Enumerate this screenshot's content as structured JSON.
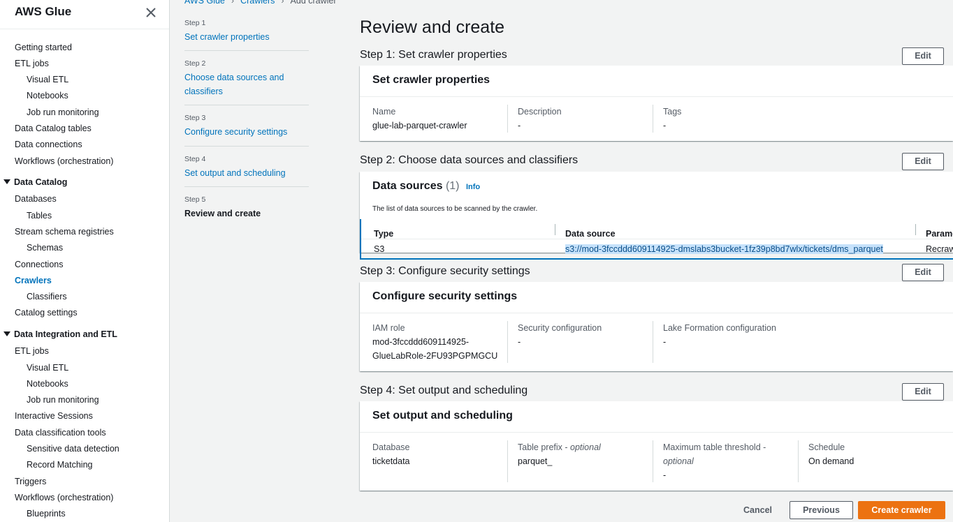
{
  "sidebar": {
    "title": "AWS Glue",
    "items": [
      {
        "label": "Getting started"
      },
      {
        "label": "ETL jobs"
      },
      {
        "label": "Visual ETL"
      },
      {
        "label": "Notebooks"
      },
      {
        "label": "Job run monitoring"
      },
      {
        "label": "Data Catalog tables"
      },
      {
        "label": "Data connections"
      },
      {
        "label": "Workflows (orchestration)"
      },
      {
        "label": "Data Catalog"
      },
      {
        "label": "Databases"
      },
      {
        "label": "Tables"
      },
      {
        "label": "Stream schema registries"
      },
      {
        "label": "Schemas"
      },
      {
        "label": "Connections"
      },
      {
        "label": "Crawlers"
      },
      {
        "label": "Classifiers"
      },
      {
        "label": "Catalog settings"
      },
      {
        "label": "Data Integration and ETL"
      },
      {
        "label": "ETL jobs"
      },
      {
        "label": "Visual ETL"
      },
      {
        "label": "Notebooks"
      },
      {
        "label": "Job run monitoring"
      },
      {
        "label": "Interactive Sessions"
      },
      {
        "label": "Data classification tools"
      },
      {
        "label": "Sensitive data detection"
      },
      {
        "label": "Record Matching"
      },
      {
        "label": "Triggers"
      },
      {
        "label": "Workflows (orchestration)"
      },
      {
        "label": "Blueprints"
      }
    ]
  },
  "breadcrumb": [
    "AWS Glue",
    "Crawlers",
    "Add crawler"
  ],
  "steps": [
    {
      "num": "Step 1",
      "label": "Set crawler properties"
    },
    {
      "num": "Step 2",
      "label": "Choose data sources and classifiers"
    },
    {
      "num": "Step 3",
      "label": "Configure security settings"
    },
    {
      "num": "Step 4",
      "label": "Set output and scheduling"
    },
    {
      "num": "Step 5",
      "label": "Review and create"
    }
  ],
  "main": {
    "title": "Review and create",
    "edit_label": "Edit",
    "section1": {
      "header": "Step 1: Set crawler properties",
      "card_title": "Set crawler properties",
      "fields": [
        {
          "key": "Name",
          "value": "glue-lab-parquet-crawler"
        },
        {
          "key": "Description",
          "value": "-"
        },
        {
          "key": "Tags",
          "value": "-"
        }
      ]
    },
    "section2": {
      "header": "Step 2: Choose data sources and classifiers",
      "card_title": "Data sources",
      "count": "(1)",
      "info": "Info",
      "description": "The list of data sources to be scanned by the crawler.",
      "columns": [
        "Type",
        "Data source",
        "Parameters"
      ],
      "rows": [
        {
          "type": "S3",
          "source": "s3://mod-3fccddd609114925-dmslabs3bucket-1fz39p8bd7wlx/tickets/dms_parquet",
          "params": "Recrawl all"
        }
      ]
    },
    "section3": {
      "header": "Step 3: Configure security settings",
      "card_title": "Configure security settings",
      "fields": [
        {
          "key": "IAM role",
          "value_line1": "mod-3fccddd609114925-",
          "value_line2": "GlueLabRole-2FU93PGPMGCU"
        },
        {
          "key": "Security configuration",
          "value": "-"
        },
        {
          "key": "Lake Formation configuration",
          "value": "-"
        }
      ]
    },
    "section4": {
      "header": "Step 4: Set output and scheduling",
      "card_title": "Set output and scheduling",
      "fields": [
        {
          "key": "Database",
          "value": "ticketdata"
        },
        {
          "key": "Table prefix - ",
          "key_optional": "optional",
          "value": "parquet_"
        },
        {
          "key": "Maximum table threshold - ",
          "key_optional": "optional",
          "value": "-"
        },
        {
          "key": "Schedule",
          "value": "On demand"
        }
      ]
    }
  },
  "footer": {
    "cancel": "Cancel",
    "previous": "Previous",
    "create": "Create crawler"
  },
  "colors": {
    "link": "#0073bb",
    "primary": "#ec7211",
    "background": "#f2f3f3"
  }
}
